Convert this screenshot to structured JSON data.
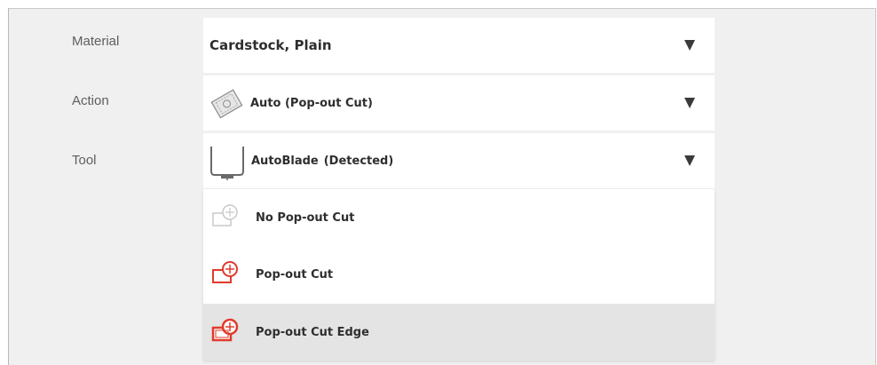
{
  "material": {
    "label": "Material",
    "value": "Cardstock, Plain"
  },
  "action": {
    "label": "Action",
    "value": "Auto (Pop-out Cut)"
  },
  "tool": {
    "label": "Tool",
    "value": "AutoBlade",
    "status": "(Detected)"
  },
  "action_options": [
    {
      "label": "No Pop-out Cut",
      "icon": "no-pop-out-cut-icon"
    },
    {
      "label": "Pop-out Cut",
      "icon": "pop-out-cut-icon"
    },
    {
      "label": "Pop-out Cut Edge",
      "icon": "pop-out-cut-edge-icon",
      "selected": true
    }
  ],
  "colors": {
    "accent_detected": "#2fb4d8",
    "icon_red": "#e03a2c",
    "icon_gray": "#c8c8c8"
  }
}
